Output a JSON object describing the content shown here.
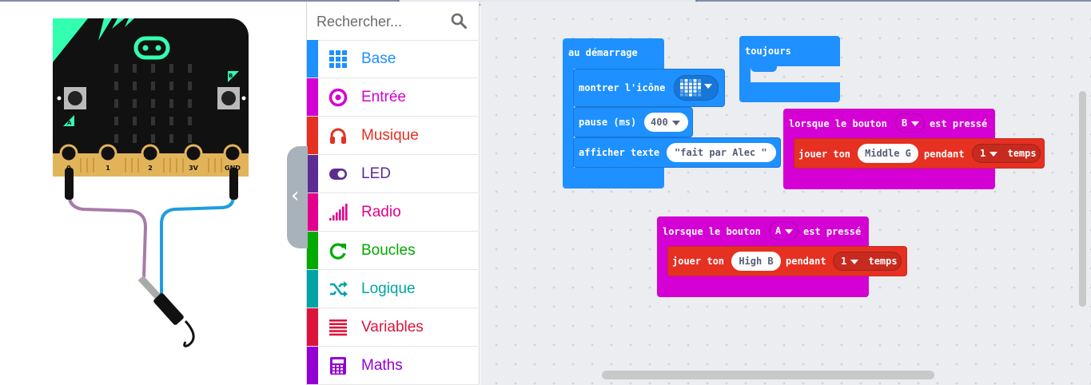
{
  "app": {
    "accent": "#2196f3"
  },
  "simulator": {
    "pins": [
      "0",
      "1",
      "2",
      "3V",
      "GND"
    ],
    "button_a": "A",
    "button_b": "B"
  },
  "toolbox": {
    "search_placeholder": "Rechercher...",
    "categories": [
      {
        "label": "Base",
        "color": "#1e90ff",
        "icon": "grid-icon"
      },
      {
        "label": "Entrée",
        "color": "#d400d4",
        "icon": "target-icon"
      },
      {
        "label": "Musique",
        "color": "#e63022",
        "icon": "headphones-icon"
      },
      {
        "label": "LED",
        "color": "#5c2d91",
        "icon": "toggle-icon"
      },
      {
        "label": "Radio",
        "color": "#e3008c",
        "icon": "signal-bars-icon"
      },
      {
        "label": "Boucles",
        "color": "#00aa00",
        "icon": "refresh-icon"
      },
      {
        "label": "Logique",
        "color": "#00a4a6",
        "icon": "shuffle-icon"
      },
      {
        "label": "Variables",
        "color": "#dc143c",
        "icon": "list-lines-icon"
      },
      {
        "label": "Maths",
        "color": "#9400d3",
        "icon": "calculator-icon"
      }
    ]
  },
  "blocks": {
    "on_start": {
      "label": "au démarrage",
      "show_icon": "montrer l'icône",
      "pause": "pause (ms)",
      "pause_value": "400",
      "show_string": "afficher texte",
      "string_value": "\"fait par Alec \""
    },
    "forever": {
      "label": "toujours"
    },
    "button_b": {
      "prefix": "lorsque le bouton",
      "button": "B",
      "suffix": "est pressé",
      "play": "jouer ton",
      "note": "Middle G",
      "for": "pendant",
      "beats": "1",
      "beats_unit": "temps"
    },
    "button_a": {
      "prefix": "lorsque le bouton",
      "button": "A",
      "suffix": "est pressé",
      "play": "jouer ton",
      "note": "High B",
      "for": "pendant",
      "beats": "1",
      "beats_unit": "temps"
    }
  },
  "colors": {
    "basic_block": "#1e90ff",
    "input_block": "#d400d4",
    "music_block": "#e63022",
    "microbit_green": "#33ffb0",
    "board": "#111111"
  }
}
